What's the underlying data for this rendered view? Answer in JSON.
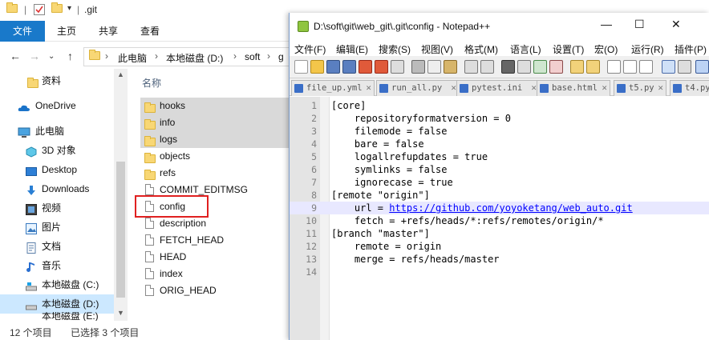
{
  "explorer": {
    "title": ".git",
    "ribbon_tabs": [
      "文件",
      "主页",
      "共享",
      "查看"
    ],
    "address_path": [
      "此电脑",
      "本地磁盘 (D:)",
      "soft",
      "g"
    ],
    "sidebar": [
      {
        "label": "资料",
        "icon": "folder-icon"
      },
      {
        "label": "OneDrive",
        "icon": "onedrive-icon"
      },
      {
        "label": "此电脑",
        "icon": "pc-icon"
      },
      {
        "label": "3D 对象",
        "icon": "3d-objects-icon"
      },
      {
        "label": "Desktop",
        "icon": "desktop-icon"
      },
      {
        "label": "Downloads",
        "icon": "download-icon"
      },
      {
        "label": "视频",
        "icon": "video-icon"
      },
      {
        "label": "图片",
        "icon": "picture-icon"
      },
      {
        "label": "文档",
        "icon": "document-icon"
      },
      {
        "label": "音乐",
        "icon": "music-icon"
      },
      {
        "label": "本地磁盘 (C:)",
        "icon": "drive-icon"
      },
      {
        "label": "本地磁盘 (D:)",
        "icon": "drive-icon"
      },
      {
        "label": "本地磁盘 (E:)",
        "icon": "drive-icon"
      }
    ],
    "column_header": "名称",
    "files": [
      {
        "name": "hooks",
        "type": "folder"
      },
      {
        "name": "info",
        "type": "folder"
      },
      {
        "name": "logs",
        "type": "folder"
      },
      {
        "name": "objects",
        "type": "folder"
      },
      {
        "name": "refs",
        "type": "folder"
      },
      {
        "name": "COMMIT_EDITMSG",
        "type": "file"
      },
      {
        "name": "config",
        "type": "file"
      },
      {
        "name": "description",
        "type": "file"
      },
      {
        "name": "FETCH_HEAD",
        "type": "file"
      },
      {
        "name": "HEAD",
        "type": "file"
      },
      {
        "name": "index",
        "type": "file"
      },
      {
        "name": "ORIG_HEAD",
        "type": "file"
      }
    ],
    "status_count": "12 个项目",
    "status_selected": "已选择 3 个项目",
    "colors": {
      "ribbon_file": "#1979ca",
      "selection": "#d9d9d9",
      "highlight_box": "#e02020"
    }
  },
  "notepad": {
    "title": "D:\\soft\\git\\web_git\\.git\\config - Notepad++",
    "window_buttons": {
      "minimize": "—",
      "maximize": "☐",
      "close": "✕"
    },
    "menu": [
      "文件(F)",
      "编辑(E)",
      "搜索(S)",
      "视图(V)",
      "格式(M)",
      "语言(L)",
      "设置(T)",
      "宏(O)",
      "运行(R)",
      "插件(P)"
    ],
    "tabs": [
      "file_up.yml",
      "run_all.py",
      "pytest.ini",
      "base.html",
      "t5.py",
      "t4.py"
    ],
    "lines": [
      "[core]",
      "    repositoryformatversion = 0",
      "    filemode = false",
      "    bare = false",
      "    logallrefupdates = true",
      "    symlinks = false",
      "    ignorecase = true",
      "[remote \"origin\"]",
      "    url = ",
      "    fetch = +refs/heads/*:refs/remotes/origin/*",
      "[branch \"master\"]",
      "    remote = origin",
      "    merge = refs/heads/master",
      ""
    ],
    "line_numbers": [
      "1",
      "2",
      "3",
      "4",
      "5",
      "6",
      "7",
      "8",
      "9",
      "10",
      "11",
      "12",
      "13",
      "14"
    ],
    "url_value": "https://github.com/yoyoketang/web_auto.git",
    "current_line": 9,
    "colors": {
      "current_line": "#e8e8ff",
      "url": "#0000ff",
      "gutter": "#e4e4e4"
    }
  }
}
